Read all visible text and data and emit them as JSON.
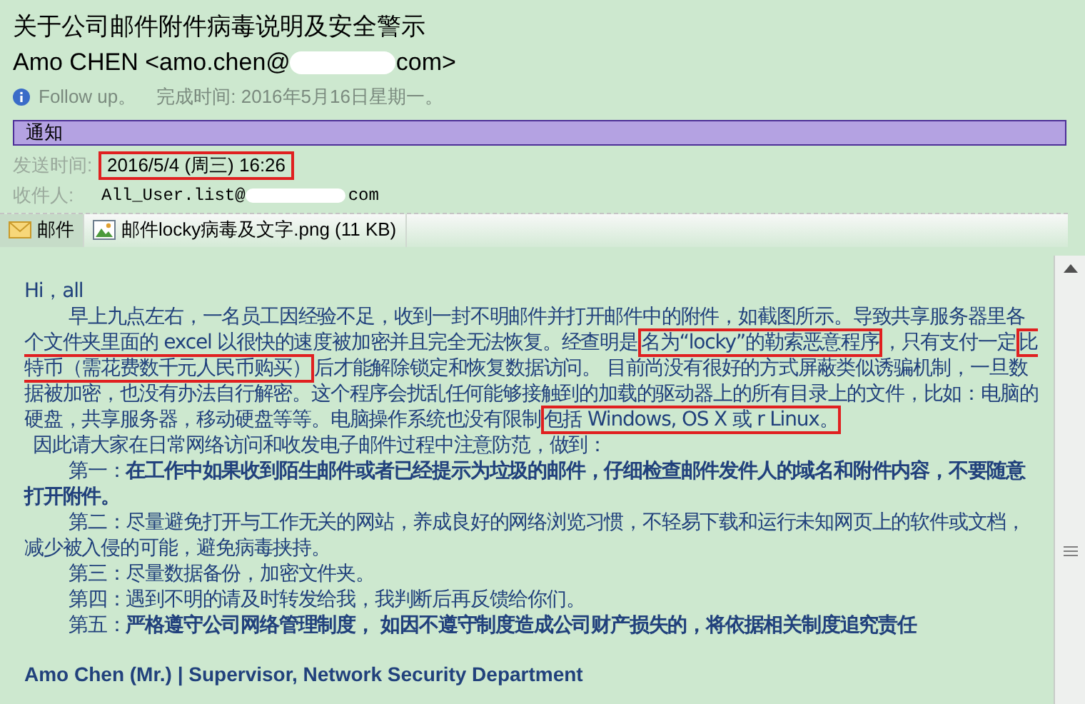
{
  "subject": "关于公司邮件附件病毒说明及安全警示",
  "sender": {
    "prefix": "Amo CHEN <amo.chen@",
    "suffix": "com>"
  },
  "follow_up": {
    "flag": "Follow up。",
    "completed": "完成时间: 2016年5月16日星期一。"
  },
  "banner": "通知",
  "sent": {
    "label": "发送时间:",
    "value": "2016/5/4 (周三) 16:26",
    "highlight": true
  },
  "recipient": {
    "label": "收件人:",
    "prefix": "All_User.list@",
    "suffix": "com"
  },
  "tabs": [
    {
      "label": "邮件",
      "kind": "mail",
      "selected": true
    },
    {
      "label": "邮件locky病毒及文字.png (11 KB)",
      "kind": "image",
      "selected": false
    }
  ],
  "body": {
    "greeting": "Hi，all",
    "paragraphs": [
      {
        "kind": "indented",
        "segments": [
          {
            "text": "早上九点左右，一名员工因经验不足，收到一封不明邮件并打开邮件中的附件，如截图所示。导致共享服务器里各个文件夹里面的 excel 以很快的速度被加密并且完全无法恢复。经查明是",
            "bold": false,
            "highlight": false
          },
          {
            "text": "名为“locky”的勒索恶意程序",
            "bold": false,
            "highlight": true
          },
          {
            "text": "，只有支付一定",
            "bold": false,
            "highlight": false
          },
          {
            "text": "比特币（需花费数千元人民币购买）",
            "bold": false,
            "highlight": true
          },
          {
            "text": "后才能解除锁定和恢复数据访问。 目前尚没有很好的方式屏蔽类似诱骗机制，一旦数据被加密，也没有办法自行解密。这个程序会扰乱任何能够接触到的加载的驱动器上的所有目录上的文件，比如：电脑的硬盘，共享服务器，移动硬盘等等。电脑操作系统也没有限制",
            "bold": false,
            "highlight": false
          },
          {
            "text": "包括 Windows, OS X 或 r Linux。",
            "bold": false,
            "highlight": true
          }
        ]
      },
      {
        "kind": "plain",
        "segments": [
          {
            "text": "因此请大家在日常网络访问和收发电子邮件过程中注意防范，做到：",
            "bold": false,
            "highlight": false
          }
        ]
      },
      {
        "kind": "indented",
        "segments": [
          {
            "text": "第一：",
            "bold": false,
            "highlight": false
          },
          {
            "text": "在工作中如果收到陌生邮件或者已经提示为垃圾的邮件，仔细检查邮件发件人的域名和附件内容，不要随意打开附件。",
            "bold": true,
            "highlight": false
          }
        ]
      },
      {
        "kind": "indented",
        "segments": [
          {
            "text": "第二：尽量避免打开与工作无关的网站，养成良好的网络浏览习惯，不轻易下载和运行未知网页上的软件或文档，减少被入侵的可能，避免病毒挟持。",
            "bold": false,
            "highlight": false
          }
        ]
      },
      {
        "kind": "indented",
        "segments": [
          {
            "text": "第三：尽量数据备份，加密文件夹。",
            "bold": false,
            "highlight": false
          }
        ]
      },
      {
        "kind": "indented",
        "segments": [
          {
            "text": "第四：遇到不明的请及时转发给我，我判断后再反馈给你们。",
            "bold": false,
            "highlight": false
          }
        ]
      },
      {
        "kind": "indented",
        "segments": [
          {
            "text": "第五：",
            "bold": false,
            "highlight": false
          },
          {
            "text": "严格遵守公司网络管理制度， 如因不遵守制度造成公司财产损失的，将依据相关制度追究责任",
            "bold": true,
            "highlight": false
          }
        ]
      }
    ],
    "signature": "Amo Chen (Mr.) | Supervisor, Network Security Department"
  }
}
